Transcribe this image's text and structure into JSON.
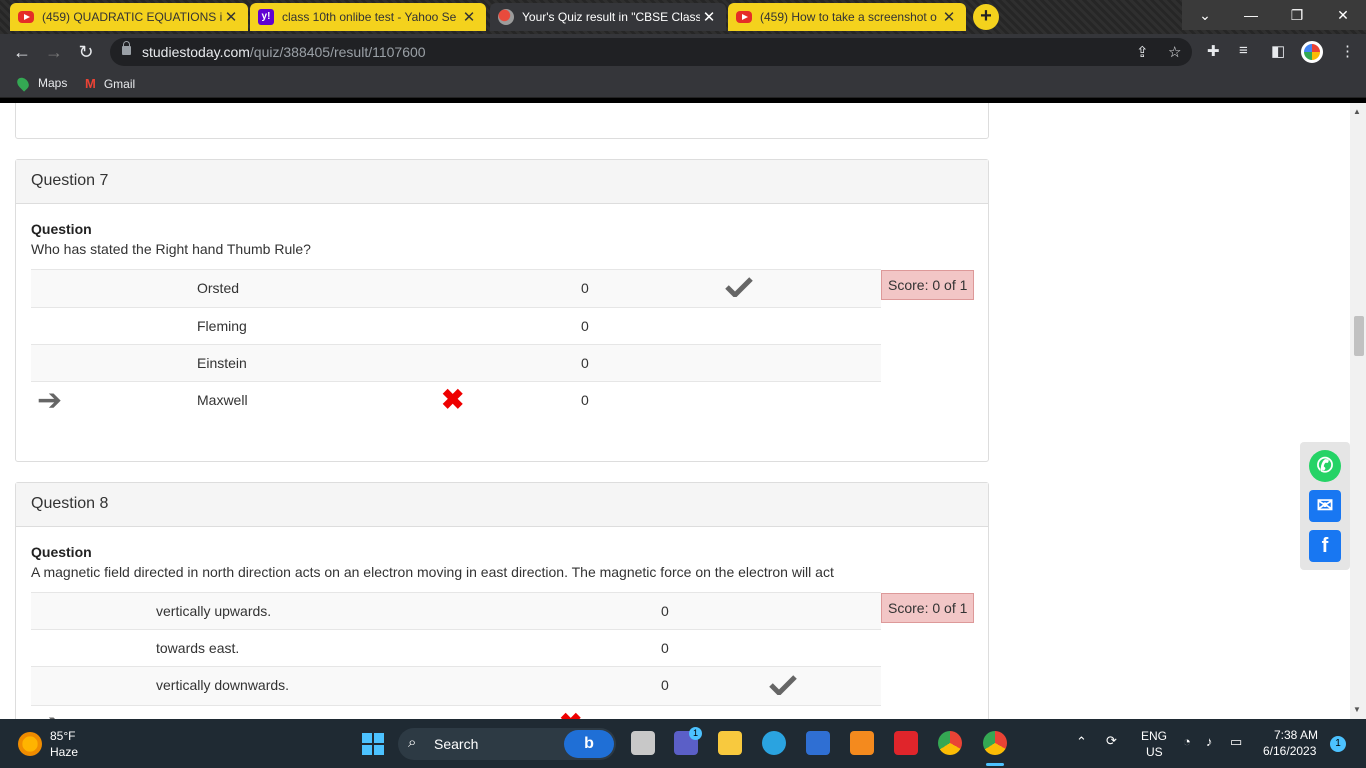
{
  "browser": {
    "tabs": [
      {
        "title": "(459) QUADRATIC EQUATIONS in",
        "icon": "youtube-icon",
        "active": false
      },
      {
        "title": "class 10th onlibe test - Yahoo Se",
        "icon": "yahoo-icon",
        "active": false
      },
      {
        "title": "Your's Quiz result in \"CBSE Class",
        "icon": "quiz-icon",
        "active": true
      },
      {
        "title": "(459) How to take a screenshot o",
        "icon": "youtube-icon",
        "active": false
      }
    ],
    "close_glyph": "✕",
    "new_tab_glyph": "+",
    "url_domain": "studiestoday.com",
    "url_path": "/quiz/388405/result/1107600",
    "bookmarks": [
      {
        "label": "Maps",
        "icon": "maps-pin-icon"
      },
      {
        "label": "Gmail",
        "icon": "gmail-icon"
      }
    ]
  },
  "questions": [
    {
      "header": "Question 7",
      "label": "Question",
      "text": "Who has stated the Right hand Thumb Rule?",
      "score": "Score: 0 of 1",
      "options": [
        {
          "text": "Orsted",
          "count": "0",
          "correct": true,
          "selected": false
        },
        {
          "text": "Fleming",
          "count": "0",
          "correct": false,
          "selected": false
        },
        {
          "text": "Einstein",
          "count": "0",
          "correct": false,
          "selected": false
        },
        {
          "text": "Maxwell",
          "count": "0",
          "correct": false,
          "selected": true
        }
      ]
    },
    {
      "header": "Question 8",
      "label": "Question",
      "text": "A magnetic field directed in north direction acts on an electron moving in east direction. The magnetic force on the electron will act",
      "score": "Score: 0 of 1",
      "options": [
        {
          "text": "vertically upwards.",
          "count": "0",
          "correct": false,
          "selected": false
        },
        {
          "text": "towards east.",
          "count": "0",
          "correct": false,
          "selected": false
        },
        {
          "text": "vertically downwards.",
          "count": "0",
          "correct": true,
          "selected": false
        }
      ]
    }
  ],
  "share": [
    {
      "name": "whatsapp",
      "color": "#25d366",
      "glyph": "✆"
    },
    {
      "name": "email",
      "color": "#1877f2",
      "glyph": "✉"
    },
    {
      "name": "facebook",
      "color": "#1877f2",
      "glyph": "f"
    }
  ],
  "taskbar": {
    "weather_temp": "85°F",
    "weather_desc": "Haze",
    "search_label": "Search",
    "lang": "ENG",
    "region": "US",
    "time": "7:38 AM",
    "date": "6/16/2023",
    "notif_count": "1",
    "teams_badge": "1"
  },
  "colors": {
    "accent_yellow": "#f4d21d",
    "score_bg": "#f2c6c6",
    "wrong_red": "#e00000",
    "check_gray": "#666666"
  }
}
